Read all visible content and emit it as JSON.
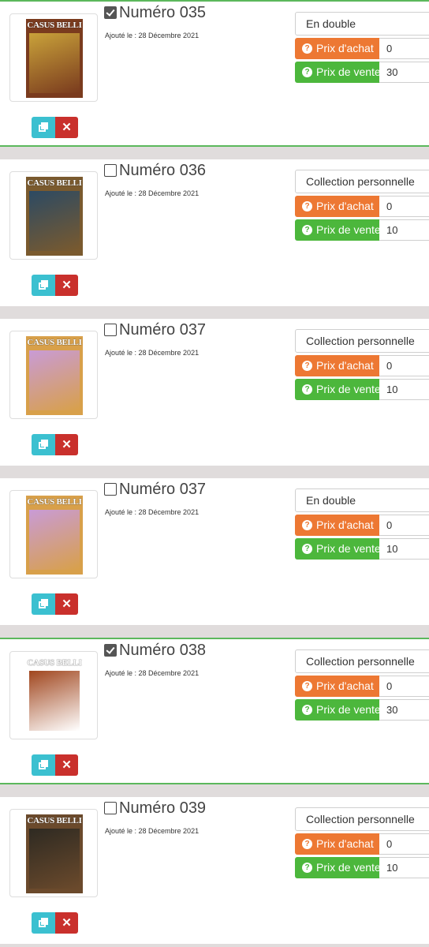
{
  "cover_title": "CASUS BELLI",
  "icons": {
    "duplicate": "duplicate-icon",
    "delete": "times-icon",
    "help": "question-circle-icon"
  },
  "colors": {
    "selected_border": "#5cb85c",
    "buy": "#ed7833",
    "sell": "#4cb73c",
    "duplicate": "#3bc0d0",
    "delete": "#c9302c"
  },
  "items": [
    {
      "title": "Numéro 035",
      "added": "Ajouté le : 28 Décembre 2021",
      "checked": true,
      "status": "En double",
      "buy_label": "Prix d'achat",
      "buy_value": "0",
      "sell_label": "Prix de vente",
      "sell_value": "30",
      "cover_icon": "magazine-cover-icon",
      "cover_colors": [
        "#c9a23a",
        "#7a3b1e"
      ]
    },
    {
      "title": "Numéro 036",
      "added": "Ajouté le : 28 Décembre 2021",
      "checked": false,
      "status": "Collection personnelle",
      "buy_label": "Prix d'achat",
      "buy_value": "0",
      "sell_label": "Prix de vente",
      "sell_value": "10",
      "cover_icon": "magazine-cover-icon",
      "cover_colors": [
        "#2c4a63",
        "#7a5a2e"
      ]
    },
    {
      "title": "Numéro 037",
      "added": "Ajouté le : 28 Décembre 2021",
      "checked": false,
      "status": "Collection personnelle",
      "buy_label": "Prix d'achat",
      "buy_value": "0",
      "sell_label": "Prix de vente",
      "sell_value": "10",
      "cover_icon": "magazine-cover-icon",
      "cover_colors": [
        "#c99bd6",
        "#d8a04a"
      ]
    },
    {
      "title": "Numéro 037",
      "added": "Ajouté le : 28 Décembre 2021",
      "checked": false,
      "status": "En double",
      "buy_label": "Prix d'achat",
      "buy_value": "0",
      "sell_label": "Prix de vente",
      "sell_value": "10",
      "cover_icon": "magazine-cover-icon",
      "cover_colors": [
        "#c99bd6",
        "#d8a04a"
      ]
    },
    {
      "title": "Numéro 038",
      "added": "Ajouté le : 28 Décembre 2021",
      "checked": true,
      "status": "Collection personnelle",
      "buy_label": "Prix d'achat",
      "buy_value": "0",
      "sell_label": "Prix de vente",
      "sell_value": "30",
      "cover_icon": "magazine-cover-icon",
      "cover_colors": [
        "#a0461e",
        "#ffffff"
      ]
    },
    {
      "title": "Numéro 039",
      "added": "Ajouté le : 28 Décembre 2021",
      "checked": false,
      "status": "Collection personnelle",
      "buy_label": "Prix d'achat",
      "buy_value": "0",
      "sell_label": "Prix de vente",
      "sell_value": "10",
      "cover_icon": "magazine-cover-icon",
      "cover_colors": [
        "#2e2a22",
        "#6b4a2c"
      ]
    }
  ]
}
